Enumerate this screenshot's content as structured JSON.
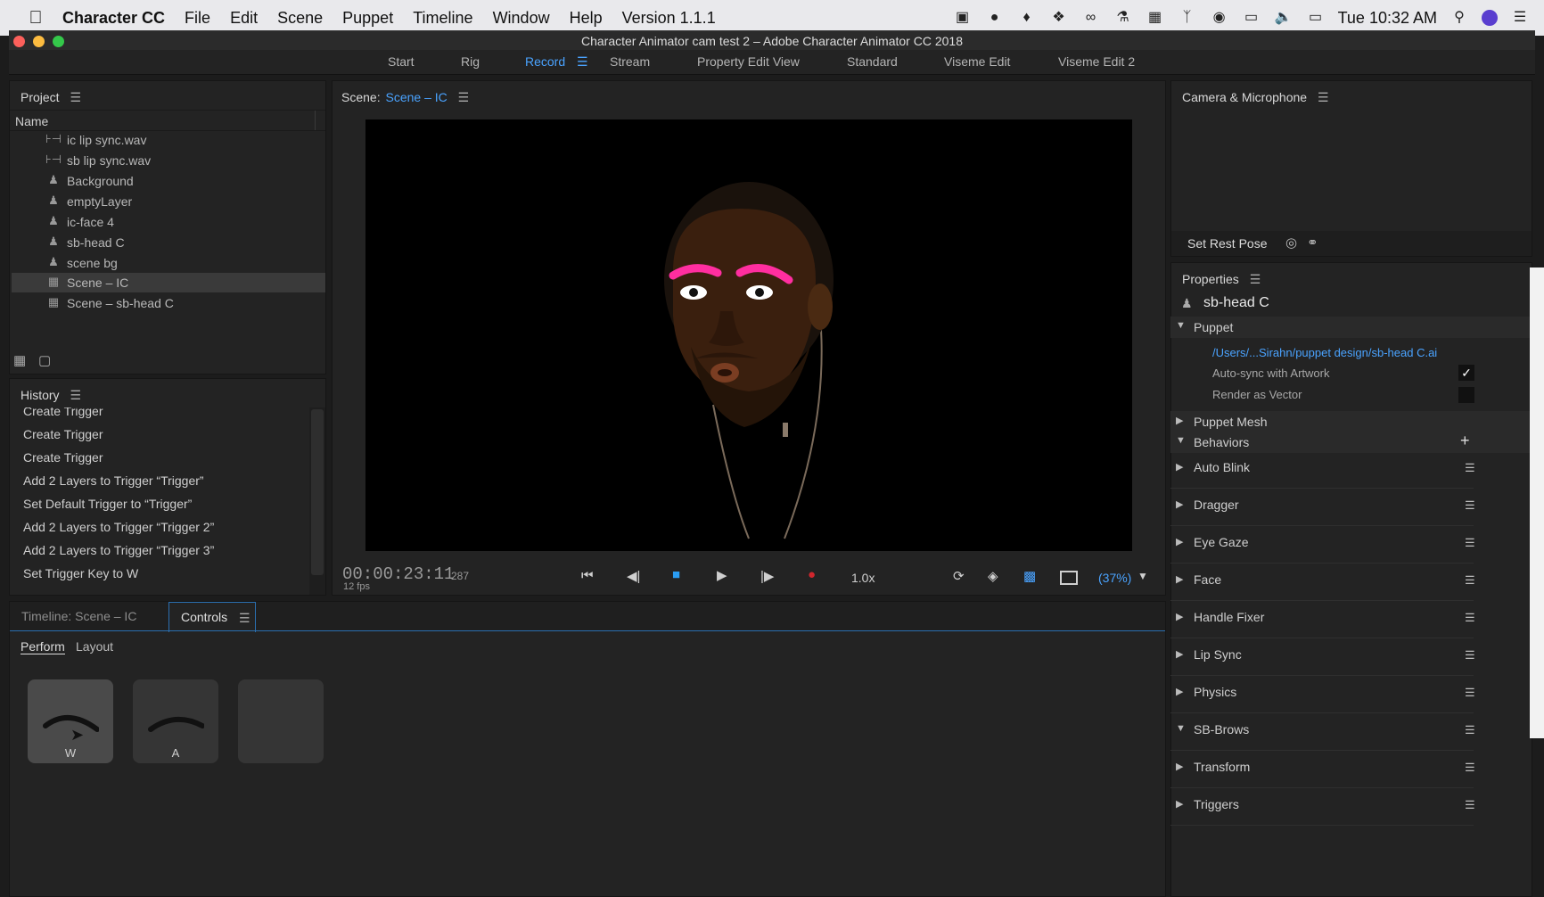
{
  "menubar": {
    "app_name": "Character CC",
    "items": [
      "File",
      "Edit",
      "Scene",
      "Puppet",
      "Timeline",
      "Window",
      "Help",
      "Version 1.1.1"
    ],
    "clock": "Tue 10:32 AM"
  },
  "window": {
    "title": "Character Animator cam test 2 – Adobe Character Animator CC 2018"
  },
  "workspaces": {
    "items": [
      "Start",
      "Rig",
      "Record",
      "Stream",
      "Property Edit View",
      "Standard",
      "Viseme Edit",
      "Viseme Edit 2"
    ],
    "active": "Record"
  },
  "project": {
    "title": "Project",
    "column_name": "Name",
    "items": [
      {
        "label": "ic lip sync.wav",
        "icon": "audio-icon"
      },
      {
        "label": "sb lip sync.wav",
        "icon": "audio-icon"
      },
      {
        "label": "Background",
        "icon": "puppet-icon"
      },
      {
        "label": "emptyLayer",
        "icon": "puppet-icon"
      },
      {
        "label": "ic-face 4",
        "icon": "puppet-icon"
      },
      {
        "label": "sb-head C",
        "icon": "puppet-icon"
      },
      {
        "label": "scene bg",
        "icon": "puppet-icon"
      },
      {
        "label": "Scene – IC",
        "icon": "scene-icon"
      },
      {
        "label": "Scene – sb-head C",
        "icon": "scene-icon"
      }
    ]
  },
  "history": {
    "title": "History",
    "items": [
      "Create Trigger",
      "Create Trigger",
      "Create Trigger",
      "Add 2 Layers to Trigger “Trigger”",
      "Set Default Trigger to “Trigger”",
      "Add 2 Layers to Trigger “Trigger 2”",
      "Add 2 Layers to Trigger “Trigger 3”",
      "Set Trigger Key to W"
    ]
  },
  "scene": {
    "label": "Scene:",
    "name": "Scene – IC",
    "timecode": "00:00:23:11",
    "frame": "287",
    "fps": "12 fps",
    "speed": "1.0x",
    "zoom": "(37%)"
  },
  "bottom_tabs": {
    "timeline": "Timeline: Scene – IC",
    "controls": "Controls"
  },
  "controls": {
    "subtabs": [
      "Perform",
      "Layout"
    ],
    "triggers": [
      {
        "key": "W"
      },
      {
        "key": "A"
      },
      {
        "key": ""
      }
    ]
  },
  "camera": {
    "title": "Camera & Microphone",
    "set_rest_pose": "Set Rest Pose"
  },
  "properties": {
    "title": "Properties",
    "puppet_name": "sb-head C",
    "section_puppet": "Puppet",
    "path": "/Users/...Sirahn/puppet design/sb-head C.ai",
    "auto_sync": "Auto-sync with Artwork",
    "render_vector": "Render as Vector",
    "puppet_mesh": "Puppet Mesh",
    "behaviors_title": "Behaviors",
    "behaviors": [
      {
        "label": "Auto Blink",
        "open": false
      },
      {
        "label": "Dragger",
        "open": false
      },
      {
        "label": "Eye Gaze",
        "open": false
      },
      {
        "label": "Face",
        "open": false
      },
      {
        "label": "Handle Fixer",
        "open": false
      },
      {
        "label": "Lip Sync",
        "open": false
      },
      {
        "label": "Physics",
        "open": false
      },
      {
        "label": "SB-Brows",
        "open": true
      },
      {
        "label": "Transform",
        "open": false
      },
      {
        "label": "Triggers",
        "open": false
      }
    ]
  },
  "colors": {
    "accent": "#4aa3ff",
    "record": "#d0262d",
    "stop": "#2a9df4",
    "brow_pink": "#ff2ea0"
  }
}
